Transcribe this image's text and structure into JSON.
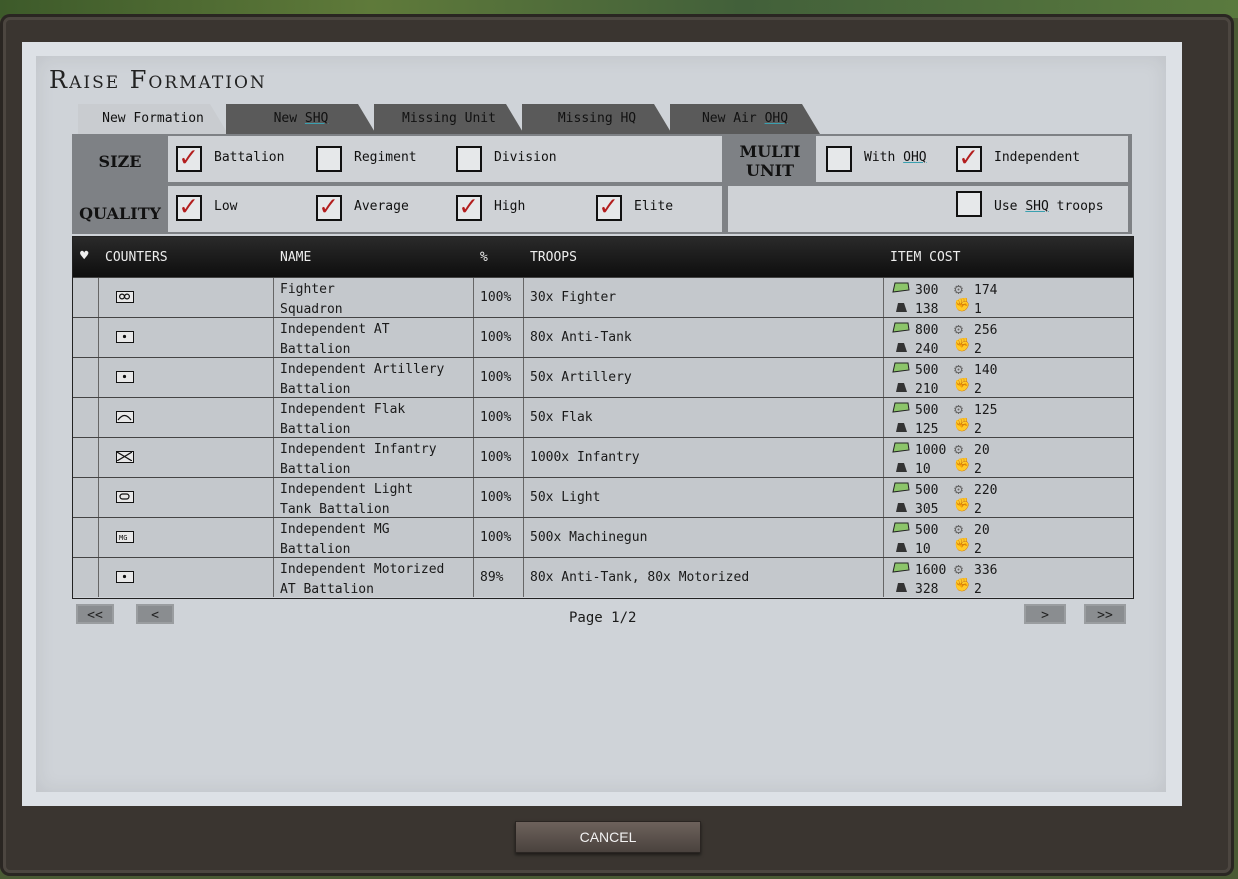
{
  "title": "Raise Formation",
  "tabs": [
    {
      "label_a": "New Formation",
      "label_u": "",
      "label_b": ""
    },
    {
      "label_a": "New ",
      "label_u": "SHQ",
      "label_b": ""
    },
    {
      "label_a": "Missing Unit",
      "label_u": "",
      "label_b": ""
    },
    {
      "label_a": "Missing HQ",
      "label_u": "",
      "label_b": ""
    },
    {
      "label_a": "New Air ",
      "label_u": "OHQ",
      "label_b": ""
    }
  ],
  "size": {
    "label": "SIZE",
    "options": [
      {
        "label": "Battalion",
        "checked": true
      },
      {
        "label": "Regiment",
        "checked": false
      },
      {
        "label": "Division",
        "checked": false
      }
    ]
  },
  "quality": {
    "label": "QUALITY",
    "options": [
      {
        "label": "Low",
        "checked": true
      },
      {
        "label": "Average",
        "checked": true
      },
      {
        "label": "High",
        "checked": true
      },
      {
        "label": "Elite",
        "checked": true
      }
    ]
  },
  "multi": {
    "label1": "MULTI",
    "label2": "UNIT",
    "with_ohq_a": "With ",
    "with_ohq_u": "OHQ",
    "with_ohq_checked": false,
    "independent": "Independent",
    "independent_checked": true,
    "use_shq_a": "Use ",
    "use_shq_u": "SHQ",
    "use_shq_b": " troops",
    "use_shq_checked": false
  },
  "table": {
    "fav_icon": "heart-icon",
    "headers": {
      "counters": "COUNTERS",
      "name": "NAME",
      "pct": "%",
      "troops": "TROOPS",
      "cost": "ITEM COST"
    },
    "rows": [
      {
        "name1": "Fighter",
        "name2": "Squadron",
        "pct": "100%",
        "troops": "30x Fighter",
        "symbol": "air",
        "c1": "300",
        "c2": "174",
        "c3": "138",
        "c4": "1"
      },
      {
        "name1": "Independent AT",
        "name2": "Battalion",
        "pct": "100%",
        "troops": "80x Anti-Tank",
        "symbol": "dot",
        "c1": "800",
        "c2": "256",
        "c3": "240",
        "c4": "2"
      },
      {
        "name1": "Independent Artillery",
        "name2": "Battalion",
        "pct": "100%",
        "troops": "50x Artillery",
        "symbol": "dot",
        "c1": "500",
        "c2": "140",
        "c3": "210",
        "c4": "2"
      },
      {
        "name1": "Independent Flak",
        "name2": "Battalion",
        "pct": "100%",
        "troops": "50x Flak",
        "symbol": "flak",
        "c1": "500",
        "c2": "125",
        "c3": "125",
        "c4": "2"
      },
      {
        "name1": "Independent Infantry",
        "name2": "Battalion",
        "pct": "100%",
        "troops": "1000x Infantry",
        "symbol": "inf",
        "c1": "1000",
        "c2": "20",
        "c3": "10",
        "c4": "2"
      },
      {
        "name1": "Independent Light",
        "name2": "Tank Battalion",
        "pct": "100%",
        "troops": "50x Light",
        "symbol": "tank",
        "c1": "500",
        "c2": "220",
        "c3": "305",
        "c4": "2"
      },
      {
        "name1": "Independent MG",
        "name2": "Battalion",
        "pct": "100%",
        "troops": "500x Machinegun",
        "symbol": "mg",
        "c1": "500",
        "c2": "20",
        "c3": "10",
        "c4": "2"
      },
      {
        "name1": "Independent Motorized",
        "name2": "AT Battalion",
        "pct": "89%",
        "troops": "80x Anti-Tank, 80x Motorized",
        "symbol": "dot",
        "c1": "1600",
        "c2": "336",
        "c3": "328",
        "c4": "2"
      }
    ]
  },
  "pager": {
    "first": "<<",
    "prev": "<",
    "info": "Page 1/2",
    "next": ">",
    "last": ">>"
  },
  "cancel": "CANCEL",
  "colors": {
    "check": "#b31e1e",
    "header_bg": "#0e0e0e",
    "cost_green": "#8cc56a"
  }
}
